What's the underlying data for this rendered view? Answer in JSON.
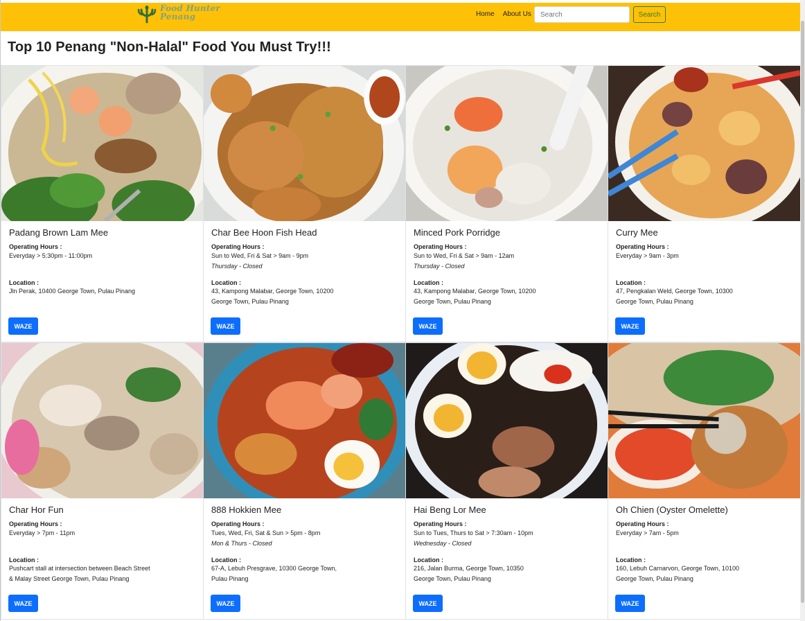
{
  "brand": {
    "line1": "Food Hunter",
    "line2": "Penang"
  },
  "nav": {
    "home": "Home",
    "about": "About Us",
    "search_placeholder": "Search",
    "search_button": "Search"
  },
  "page_title": "Top 10 Penang \"Non-Halal\" Food You Must Try!!!",
  "labels": {
    "hours": "Operating Hours :",
    "location": "Location :",
    "waze": "WAZE"
  },
  "cards": [
    {
      "title": "Padang Brown Lam Mee",
      "hours": "Everyday > 5:30pm - 11:00pm",
      "closed": "",
      "loc1": "Jln Perak, 10400 George Town, Pulau Pinang",
      "loc2": ""
    },
    {
      "title": "Char Bee Hoon Fish Head",
      "hours": "Sun to Wed, Fri & Sat > 9am - 9pm",
      "closed": "Thursday - Closed",
      "loc1": "43, Kampong Malabar, George Town, 10200",
      "loc2": "George Town, Pulau Pinang"
    },
    {
      "title": "Minced Pork Porridge",
      "hours": "Sun to Wed, Fri & Sat > 9am - 12am",
      "closed": "Thursday - Closed",
      "loc1": "43, Kampong Malabar, George Town, 10200",
      "loc2": "George Town, Pulau Pinang"
    },
    {
      "title": "Curry Mee",
      "hours": "Everyday > 9am - 3pm",
      "closed": "",
      "loc1": "47, Pengkalan Weld, George Town, 10300",
      "loc2": "George Town, Pulau Pinang"
    },
    {
      "title": "Char Hor Fun",
      "hours": "Everyday > 7pm - 11pm",
      "closed": "",
      "loc1": "Pushcart stall at intersection between Beach Street",
      "loc2": "& Malay Street George Town, Pulau Pinang"
    },
    {
      "title": "888 Hokkien Mee",
      "hours": "Tues, Wed, Fri, Sat & Sun > 5pm - 8pm",
      "closed": "Mon & Thurs - Closed",
      "loc1": "67-A, Lebuh Presgrave, 10300 George Town,",
      "loc2": "Pulau Pinang"
    },
    {
      "title": "Hai Beng Lor Mee",
      "hours": "Sun to Tues, Thurs to Sat > 7:30am - 10pm",
      "closed": "Wednesday - Closed",
      "loc1": "216, Jalan Burma, George Town, 10350",
      "loc2": "George Town, Pulau Pinang"
    },
    {
      "title": "Oh Chien (Oyster Omelette)",
      "hours": "Everyday > 7am - 5pm",
      "closed": "",
      "loc1": "160, Lebuh Carnarvon, George Town, 10100",
      "loc2": "George Town, Pulau Pinang"
    }
  ]
}
